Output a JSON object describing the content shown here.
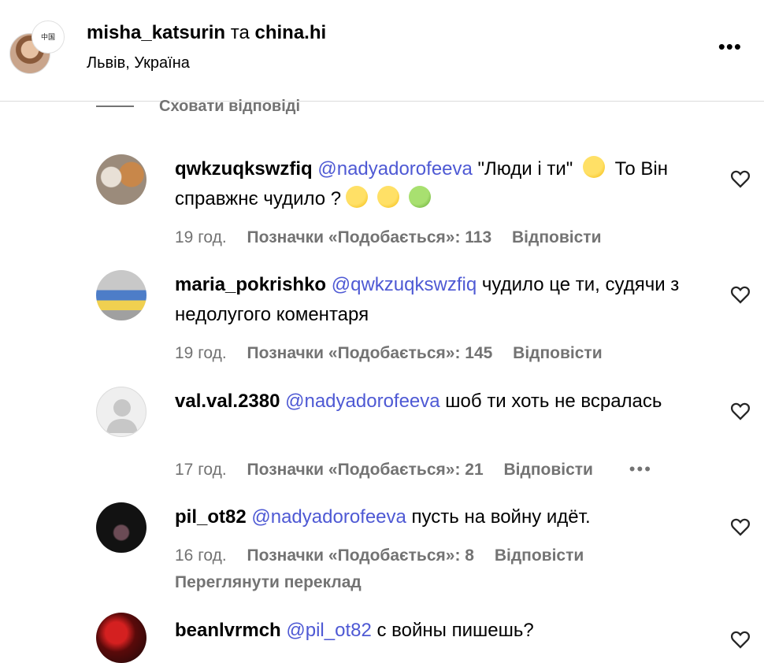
{
  "header": {
    "user1": "misha_katsurin",
    "conj": "та",
    "user2": "china.hi",
    "location": "Львів, Україна",
    "avatar2_text": "中国",
    "more_label": "•••"
  },
  "hide_replies_label": "Сховати відповіді",
  "comments": [
    {
      "username": "qwkzuqkswzfiq",
      "mention": "@nadyadorofeeva",
      "text": "\"Люди і ти\"",
      "text2": "То Він справжнє чудило ?",
      "time": "19 год.",
      "likes": "Позначки «Подобається»: 113",
      "reply": "Відповісти",
      "avatar_color": "#b08a6a"
    },
    {
      "username": "maria_pokrishko",
      "mention": "@qwkzuqkswzfiq",
      "text": "чудило це ти, судячи з недолугого коментаря",
      "time": "19 год.",
      "likes": "Позначки «Подобається»: 145",
      "reply": "Відповісти",
      "avatar_color": "#6a8fb0"
    },
    {
      "username": "val.val.2380",
      "mention": "@nadyadorofeeva",
      "text": "шоб ти хоть не всралась",
      "time": "17 год.",
      "likes": "Позначки «Подобається»: 21",
      "reply": "Відповісти",
      "more": "•••",
      "avatar_color": "#dbdbdb"
    },
    {
      "username": "pil_ot82",
      "mention": "@nadyadorofeeva",
      "text": "пусть на войну идёт.",
      "time": "16 год.",
      "likes": "Позначки «Подобається»: 8",
      "reply": "Відповісти",
      "translate": "Переглянути переклад",
      "avatar_color": "#1a1a1a"
    },
    {
      "username": "beanlvrmch",
      "mention": "@pil_ot82",
      "text": "с войны пишешь?",
      "avatar_color": "#8a1010"
    }
  ]
}
